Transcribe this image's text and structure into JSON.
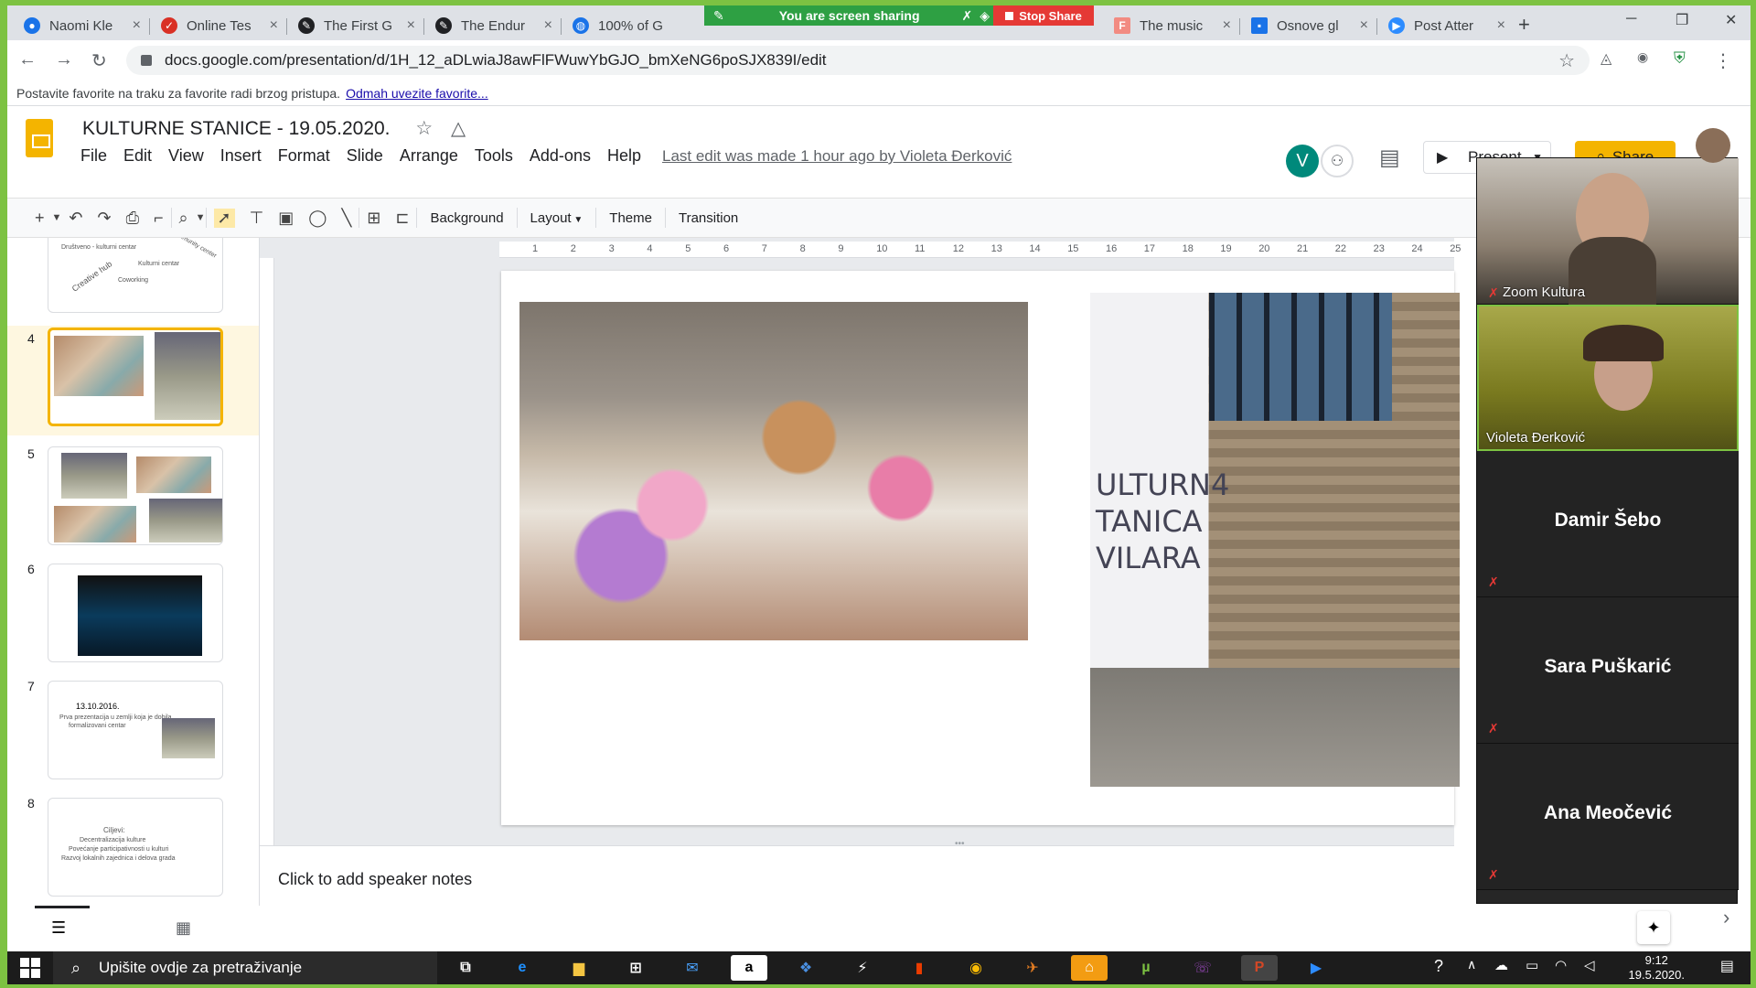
{
  "browser": {
    "tabs": [
      {
        "label": "Naomi Kle",
        "icon_color": "#1a73e8"
      },
      {
        "label": "Online Tes",
        "icon_color": "#d93025"
      },
      {
        "label": "The First G",
        "icon_color": "#202124"
      },
      {
        "label": "The Endur",
        "icon_color": "#202124"
      },
      {
        "label": "100% of G",
        "icon_color": "#1a73e8"
      },
      {
        "label": "The music",
        "icon_color": "#f28b82"
      },
      {
        "label": "Osnove gl",
        "icon_color": "#1a73e8"
      },
      {
        "label": "Post Atter",
        "icon_color": "#2d8cff"
      }
    ],
    "sharing_banner": "You are screen sharing",
    "stop_share": "Stop Share",
    "url": "docs.google.com/presentation/d/1H_12_aDLwiaJ8awFlFWuwYbGJO_bmXeNG6poSJX839I/edit",
    "bookmarks_text": "Postavite favorite na traku za favorite radi brzog pristupa.",
    "bookmarks_link": "Odmah uvezite favorite..."
  },
  "slides": {
    "title": "KULTURNE STANICE  - 19.05.2020.",
    "menu": [
      "File",
      "Edit",
      "View",
      "Insert",
      "Format",
      "Slide",
      "Arrange",
      "Tools",
      "Add-ons",
      "Help"
    ],
    "last_edit": "Last edit was made 1 hour ago by Violeta Đerković",
    "avatar_letter": "V",
    "present": "Present",
    "share": "Share",
    "toolbar": {
      "background": "Background",
      "layout": "Layout",
      "theme": "Theme",
      "transition": "Transition"
    },
    "thumbnails": [
      {
        "num": "",
        "lines": [
          "Društveno - kulturni centar",
          "Creative hub",
          "Kulturni centar",
          "Coworking",
          "Community center"
        ]
      },
      {
        "num": "4"
      },
      {
        "num": "5"
      },
      {
        "num": "6"
      },
      {
        "num": "7",
        "lines": [
          "13.10.2016.",
          "Prva prezentacija u zemlji koja je dobila",
          "formalizovani centar"
        ]
      },
      {
        "num": "8",
        "lines": [
          "Ciljevi:",
          "Decentralizacija kulture",
          "Povećanje participativnosti u kulturi",
          "Razvoj lokalnih zajednica i delova grada"
        ]
      }
    ],
    "ruler_marks": [
      "1",
      "2",
      "3",
      "4",
      "5",
      "6",
      "7",
      "8",
      "9",
      "10",
      "11",
      "12",
      "13",
      "14",
      "15",
      "16",
      "17",
      "18",
      "19",
      "20",
      "21",
      "22",
      "23",
      "24",
      "25"
    ],
    "banner_text": [
      "ULTURN4",
      "TANICA",
      "VILARA"
    ],
    "speaker_notes": "Click to add speaker notes"
  },
  "zoom": {
    "participants": [
      {
        "name": "Zoom Kultura",
        "video": true
      },
      {
        "name": "Violeta Đerković",
        "video": true
      },
      {
        "name": "Damir Šebo",
        "video": false
      },
      {
        "name": "Sara Puškarić",
        "video": false
      },
      {
        "name": "Ana Meočević",
        "video": false
      }
    ]
  },
  "taskbar": {
    "search_placeholder": "Upišite ovdje za pretraživanje",
    "time": "9:12",
    "date": "19.5.2020."
  }
}
